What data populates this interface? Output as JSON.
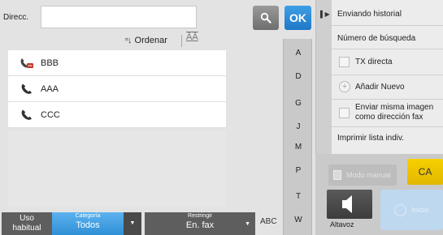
{
  "address": {
    "label": "Direcc.",
    "value": "",
    "placeholder": "",
    "ok_label": "OK"
  },
  "toolbar": {
    "sort_label": "Ordenar",
    "sort_icon": "sort-az-icon",
    "kana_label": "ĀĀ"
  },
  "contacts": [
    {
      "name": "BBB",
      "icon": "fax-group-icon"
    },
    {
      "name": "AAA",
      "icon": "phone-icon"
    },
    {
      "name": "CCC",
      "icon": "phone-icon"
    }
  ],
  "index": [
    "A",
    "D",
    "G",
    "J",
    "M",
    "P",
    "T",
    "W"
  ],
  "bottom_bar": {
    "uso_label_1": "Uso",
    "uso_label_2": "habitual",
    "categoria_caption": "Categoría",
    "categoria_value": "Todos",
    "restringir_caption": "Restringir",
    "restringir_value": "En. fax",
    "abc_label": "ABC"
  },
  "task_panel": {
    "items": [
      {
        "label": "Enviando historial"
      },
      {
        "label": "Número de búsqueda"
      },
      {
        "label": "TX directa"
      },
      {
        "label": "Añadir Nuevo"
      },
      {
        "label_1": "Enviar misma imagen",
        "label_2": "como dirección  fax"
      },
      {
        "label": "Imprimir lista indiv."
      }
    ]
  },
  "actions": {
    "modo_label": "Modo manual",
    "ca_label": "CA",
    "altavoz_label": "Altavoz",
    "send_label": "Inicio"
  },
  "colors": {
    "accent_blue": "#2f8fd6",
    "ok_blue": "#1f78c8",
    "ca_yellow": "#f2c800",
    "fax_group_red": "#c0392b"
  }
}
